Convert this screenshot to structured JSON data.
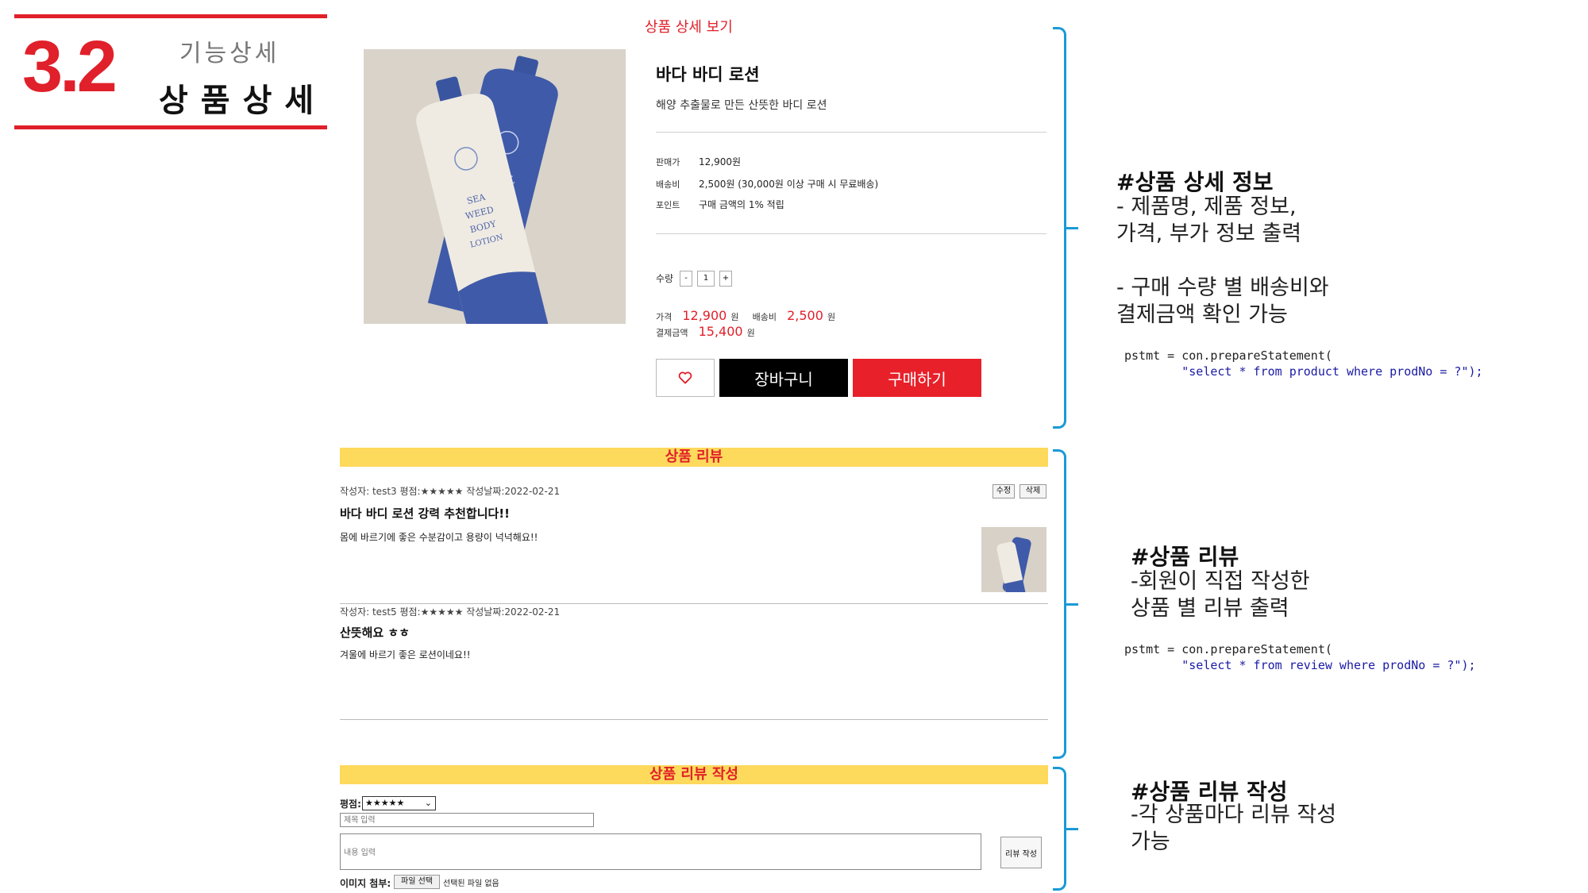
{
  "header": {
    "number": "3.2",
    "subtitle": "기능상세",
    "title": "상품상세"
  },
  "product": {
    "view_title": "상품 상세 보기",
    "name": "바다 바디 로션",
    "description": "해양 추출물로 만든 산뜻한 바디 로션",
    "bottle_front_text": "SEA\n바다\nWEED\nBODY\nLOTION",
    "bottle_back_text": "PEARL\nBODY\nLOTION",
    "info": [
      {
        "label": "판매가",
        "value": "12,900원"
      },
      {
        "label": "배송비",
        "value": "2,500원 (30,000원 이상 구매 시 무료배송)"
      },
      {
        "label": "포인트",
        "value": "구매 금액의 1% 적립"
      }
    ],
    "qty_label": "수량",
    "qty_minus": "-",
    "qty_value": "1",
    "qty_plus": "+",
    "price_label": "가격",
    "price_value": "12,900",
    "price_unit": "원",
    "ship_label": "배송비",
    "ship_value": "2,500",
    "ship_unit": "원",
    "total_label": "결제금액",
    "total_value": "15,400",
    "total_unit": "원",
    "cart_button": "장바구니",
    "buy_button": "구매하기"
  },
  "notes": {
    "detail_heading": "#상품 상세 정보",
    "detail_text": "- 제품명, 제품 정보,\n가격, 부가 정보 출력\n\n- 구매 수량 별 배송비와\n결제금액 확인 가능",
    "detail_code_1": "pstmt = con.prepareStatement(",
    "detail_code_2": "        \"select * from product where prodNo = ?\");",
    "review_heading": "#상품 리뷰",
    "review_text": "-회원이 직접 작성한\n상품 별 리뷰 출력",
    "review_code_1": "pstmt = con.prepareStatement(",
    "review_code_2": "        \"select * from review where prodNo = ?\");",
    "write_heading": "#상품 리뷰 작성",
    "write_text": "-각 상품마다 리뷰 작성\n가능"
  },
  "reviews": {
    "bar_title": "상품 리뷰",
    "edit_button": "수정",
    "delete_button": "삭제",
    "items": [
      {
        "meta": "작성자: test3   평점:★★★★★   작성날짜:2022-02-21",
        "title": "바다 바디 로션 강력 추천합니다!!",
        "body": "몸에 바르기에 좋은 수분감이고 용량이 넉넉해요!!"
      },
      {
        "meta": "작성자: test5   평점:★★★★★   작성날짜:2022-02-21",
        "title": "산뜻해요 ㅎㅎ",
        "body": "겨울에 바르기 좋은 로션이네요!!"
      }
    ]
  },
  "write": {
    "bar_title": "상품 리뷰 작성",
    "rating_label": "평점:",
    "rating_value": "★★★★★",
    "title_placeholder": "제목 입력",
    "content_placeholder": "내용 입력",
    "submit_button": "리뷰 작성",
    "attach_label": "이미지 첨부:",
    "file_button": "파일 선택",
    "file_status": "선택된 파일 없음"
  },
  "colors": {
    "accent": "#e0202a",
    "bracket": "#1a9ad6",
    "review_bar": "#fdd95c"
  }
}
